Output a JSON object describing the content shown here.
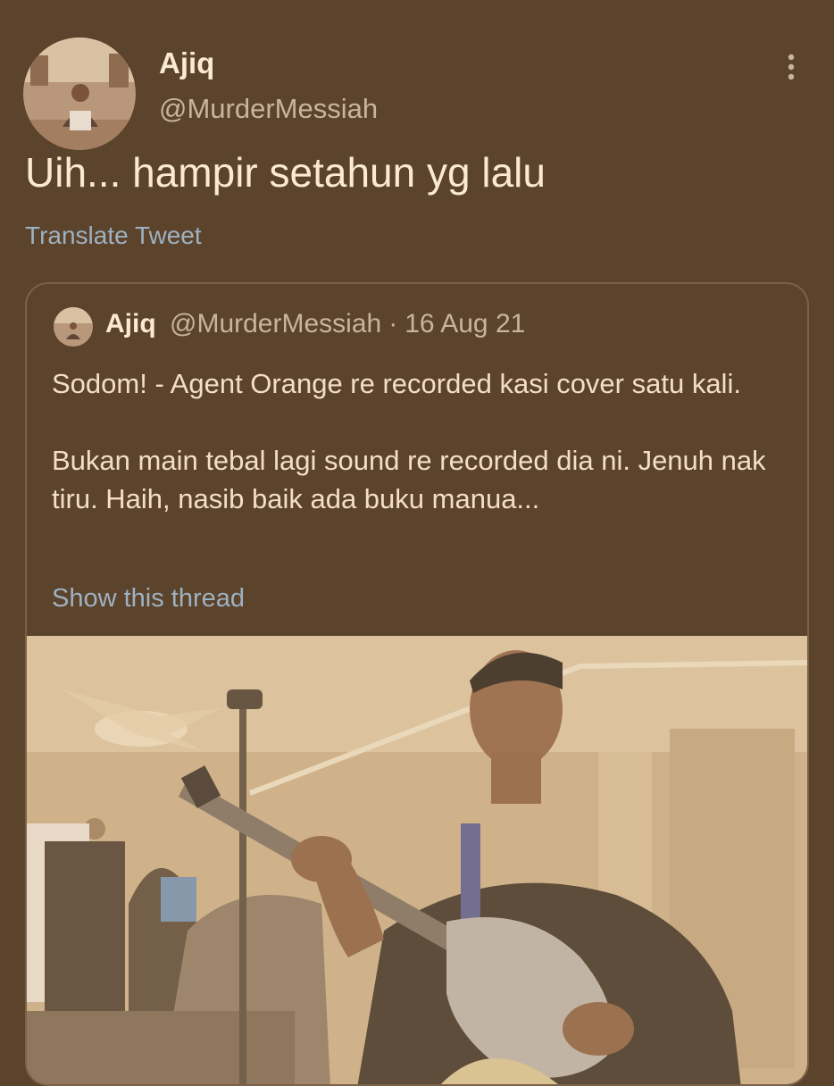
{
  "tweet": {
    "author_name": "Ajiq",
    "author_handle": "@MurderMessiah",
    "text": "Uih... hampir setahun yg lalu",
    "translate_label": "Translate Tweet"
  },
  "quoted": {
    "author_name": "Ajiq",
    "author_handle": "@MurderMessiah",
    "separator": "·",
    "date": "16 Aug 21",
    "text_line1": "Sodom! - Agent Orange re recorded kasi cover satu kali.",
    "text_line2": "Bukan main tebal lagi sound re recorded dia ni. Jenuh nak tiru. Haih, nasib baik ada buku manua...",
    "show_thread_label": "Show this thread"
  },
  "icons": {
    "more": "more-vertical-icon"
  },
  "colors": {
    "background": "#5b432c",
    "text": "#fbe9d2",
    "muted": "#c9b59b",
    "link": "#9fb1c0",
    "card_border": "#7c6249"
  }
}
